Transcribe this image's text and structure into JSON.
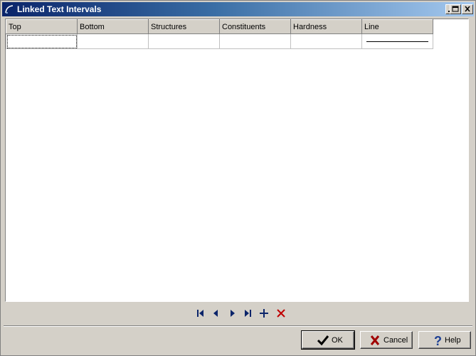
{
  "window": {
    "title": "Linked Text Intervals",
    "controls": [
      "minimize-icon",
      "maximize-icon",
      "close-icon"
    ]
  },
  "grid": {
    "columns": [
      "Top",
      "Bottom",
      "Structures",
      "Constituents",
      "Hardness",
      "Line"
    ],
    "rows": [
      [
        "",
        "",
        "",
        "",
        "",
        ""
      ]
    ]
  },
  "navigator": {
    "buttons": [
      "first-record-icon",
      "prior-record-icon",
      "next-record-icon",
      "last-record-icon",
      "insert-record-icon",
      "delete-record-icon"
    ],
    "icon_color": "#0a246a",
    "delete_color": "#c00000"
  },
  "footer": {
    "ok_label": "OK",
    "cancel_label": "Cancel",
    "help_label": "Help"
  }
}
